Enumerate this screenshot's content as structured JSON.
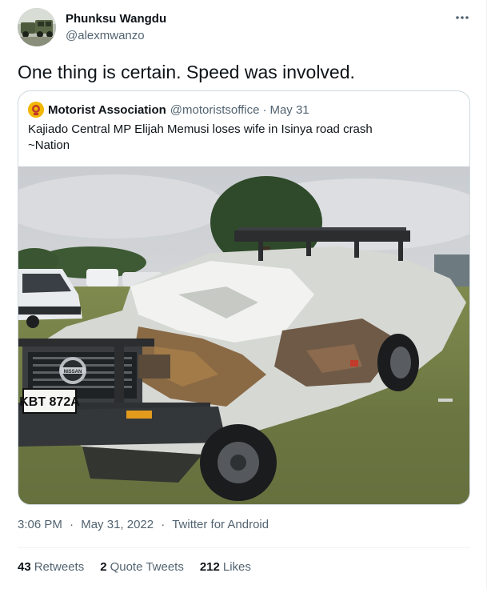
{
  "author": {
    "display_name": "Phunksu Wangdu",
    "handle": "@alexmwanzo",
    "avatar_icon": "vehicles-photo-avatar"
  },
  "more_icon": "ellipsis-icon",
  "tweet": {
    "text": "One thing is certain. Speed was involved."
  },
  "quoted": {
    "display_name": "Motorist Association",
    "handle": "@motoristsoffice",
    "separator": "·",
    "date": "May 31",
    "text_line1": "Kajiado Central MP Elijah Memusi loses wife in Isinya road crash",
    "text_line2": "~Nation",
    "image_plate": "KBT 872A",
    "image_badge": "NISSAN"
  },
  "meta": {
    "time": "3:06 PM",
    "sep1": "·",
    "date": "May 31, 2022",
    "sep2": "·",
    "source": "Twitter for Android"
  },
  "stats": {
    "retweets_count": "43",
    "retweets_label": "Retweets",
    "quotes_count": "2",
    "quotes_label": "Quote Tweets",
    "likes_count": "212",
    "likes_label": "Likes"
  },
  "colors": {
    "text_primary": "#0f1419",
    "text_secondary": "#536471",
    "border": "#cfd9de"
  }
}
